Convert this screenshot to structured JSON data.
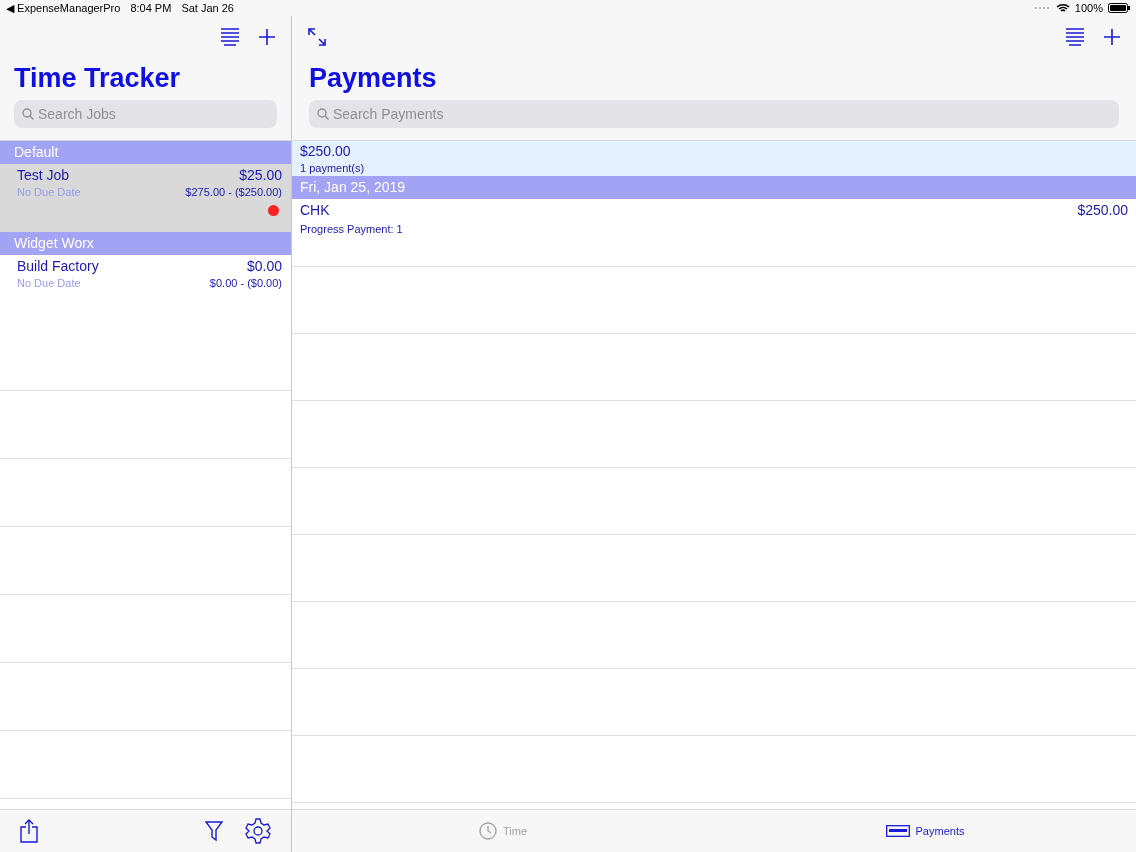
{
  "status_bar": {
    "back_app": "◀ ExpenseManagerPro",
    "time": "8:04 PM",
    "date": "Sat Jan 26",
    "battery": "100%"
  },
  "jobs_pane": {
    "title": "Time Tracker",
    "search": {
      "placeholder": "Search Jobs"
    },
    "groups": [
      {
        "name": "Default",
        "jobs": [
          {
            "name": "Test Job",
            "amount": "$25.00",
            "due": "No Due Date",
            "balance": "$275.00 - ($250.00)",
            "selected": true,
            "alert": true
          }
        ]
      },
      {
        "name": "Widget Worx",
        "jobs": [
          {
            "name": "Build Factory",
            "amount": "$0.00",
            "due": "No Due Date",
            "balance": "$0.00 - ($0.00)",
            "selected": false,
            "alert": false
          }
        ]
      }
    ]
  },
  "payments_pane": {
    "title": "Payments",
    "search": {
      "placeholder": "Search Payments"
    },
    "summary": {
      "total": "$250.00",
      "count": "1 payment(s)"
    },
    "groups": [
      {
        "date": "Fri, Jan 25, 2019",
        "payments": [
          {
            "method": "CHK",
            "amount": "$250.00",
            "note": "Progress Payment: 1"
          }
        ]
      }
    ]
  },
  "tabs": [
    {
      "label": "Time",
      "selected": false,
      "kind": "clock"
    },
    {
      "label": "Payments",
      "selected": true,
      "kind": "card"
    }
  ]
}
